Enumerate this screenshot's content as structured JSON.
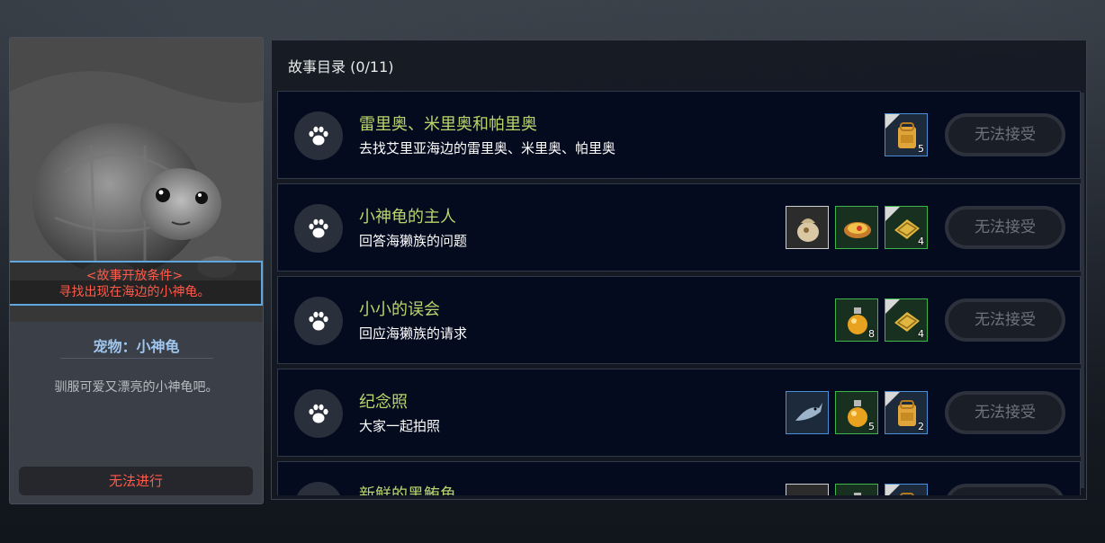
{
  "pet_panel": {
    "condition_title": "<故事开放条件>",
    "condition_text": "寻找出现在海边的小神龟。",
    "pet_name": "宠物：小神龟",
    "description": "驯服可爱又漂亮的小神龟吧。",
    "action_label": "无法进行"
  },
  "story_list": {
    "title": "故事目录 (0/11)",
    "quests": [
      {
        "title": "雷里奥、米里奥和帕里奥",
        "desc": "去找艾里亚海边的雷里奥、米里奥、帕里奥",
        "rewards": [
          {
            "icon": "backpack-icon",
            "count": "5",
            "frame": "blue"
          }
        ],
        "button": "无法接受"
      },
      {
        "title": "小神龟的主人",
        "desc": "回答海獭族的问题",
        "rewards": [
          {
            "icon": "pet-food-sack-icon",
            "count": "",
            "frame": "white"
          },
          {
            "icon": "dish-icon",
            "count": "",
            "frame": "green"
          },
          {
            "icon": "fish-basket-icon",
            "count": "4",
            "frame": "green"
          }
        ],
        "button": "无法接受"
      },
      {
        "title": "小小的误会",
        "desc": "回应海獭族的请求",
        "rewards": [
          {
            "icon": "potion-icon",
            "count": "8",
            "frame": "green"
          },
          {
            "icon": "fish-basket-icon",
            "count": "4",
            "frame": "green"
          }
        ],
        "button": "无法接受"
      },
      {
        "title": "纪念照",
        "desc": "大家一起拍照",
        "rewards": [
          {
            "icon": "fish-icon",
            "count": "",
            "frame": "blue"
          },
          {
            "icon": "potion-icon",
            "count": "5",
            "frame": "green"
          },
          {
            "icon": "backpack-icon",
            "count": "2",
            "frame": "blue"
          }
        ],
        "button": "无法接受"
      },
      {
        "title": "新鲜的黑鲔鱼",
        "desc": "",
        "rewards": [
          {
            "icon": "fish-icon",
            "count": "",
            "frame": "white"
          },
          {
            "icon": "potion-icon",
            "count": "",
            "frame": "green"
          },
          {
            "icon": "backpack-icon",
            "count": "",
            "frame": "blue"
          }
        ],
        "button": ""
      }
    ]
  },
  "colors": {
    "quest_title": "#b7d56a",
    "condition": "#ff5a4a",
    "pet_name": "#9fc6ef"
  }
}
